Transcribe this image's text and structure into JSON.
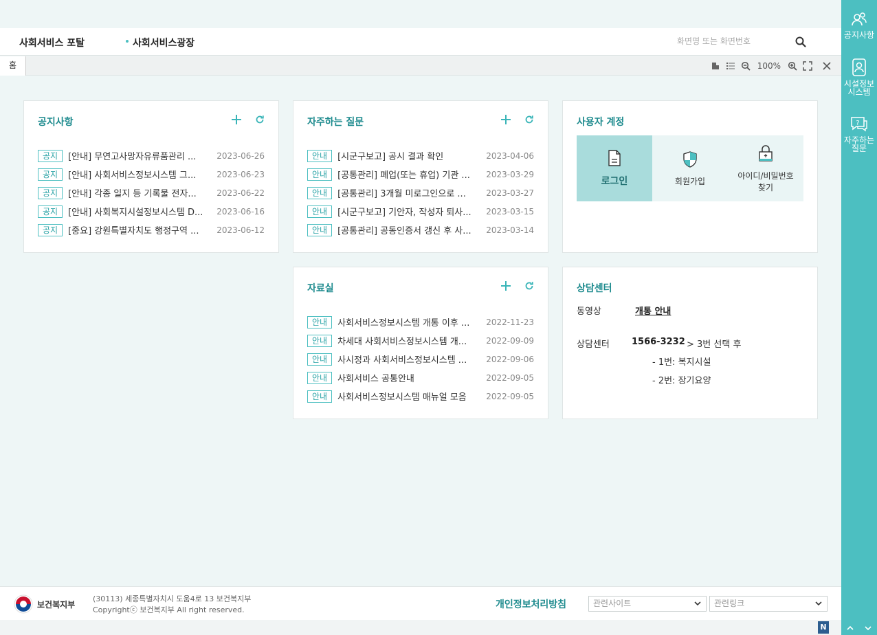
{
  "header": {
    "portal_title": "사회서비스 포탈",
    "nav_item": "사회서비스광장",
    "search_placeholder": "화면명 또는 화면번호"
  },
  "tabs": {
    "home": "홈"
  },
  "toolbar": {
    "zoom": "100%"
  },
  "notice": {
    "title": "공지사항",
    "items": [
      {
        "badge": "공지",
        "text": "[안내] 무연고사망자유류품관리 ...",
        "date": "2023-06-26"
      },
      {
        "badge": "공지",
        "text": "[안내] 사회서비스정보시스템 그...",
        "date": "2023-06-23"
      },
      {
        "badge": "공지",
        "text": "[안내] 각종 일지 등 기록물 전자...",
        "date": "2023-06-22"
      },
      {
        "badge": "공지",
        "text": "[안내] 사회복지시설정보시스템 D...",
        "date": "2023-06-16"
      },
      {
        "badge": "공지",
        "text": "[중요] 강원특별자치도 행정구역 ...",
        "date": "2023-06-12"
      }
    ]
  },
  "faq": {
    "title": "자주하는 질문",
    "items": [
      {
        "badge": "안내",
        "text": "[시군구보고] 공시 결과 확인",
        "date": "2023-04-06"
      },
      {
        "badge": "안내",
        "text": "[공통관리] 폐업(또는 휴업) 기관 ...",
        "date": "2023-03-29"
      },
      {
        "badge": "안내",
        "text": "[공통관리] 3개월 미로그인으로 ...",
        "date": "2023-03-27"
      },
      {
        "badge": "안내",
        "text": "[시군구보고] 기안자, 작성자 퇴사...",
        "date": "2023-03-15"
      },
      {
        "badge": "안내",
        "text": "[공통관리] 공동인증서 갱신 후 사...",
        "date": "2023-03-14"
      }
    ]
  },
  "account": {
    "title": "사용자 계정",
    "login": "로그인",
    "signup": "회원가입",
    "find_line1": "아이디/비밀번호",
    "find_line2": "찾기"
  },
  "library": {
    "title": "자료실",
    "items": [
      {
        "badge": "안내",
        "text": "사회서비스정보시스템 개통 이후 ...",
        "date": "2022-11-23"
      },
      {
        "badge": "안내",
        "text": "차세대 사회서비스정보시스템 개...",
        "date": "2022-09-09"
      },
      {
        "badge": "안내",
        "text": "사시정과 사회서비스정보시스템 ...",
        "date": "2022-09-06"
      },
      {
        "badge": "안내",
        "text": "사회서비스 공통안내",
        "date": "2022-09-05"
      },
      {
        "badge": "안내",
        "text": "사회서비스정보시스템 매뉴얼 모음",
        "date": "2022-09-05"
      }
    ]
  },
  "counsel": {
    "title": "상담센터",
    "video_label": "동영상",
    "video_link": "개통 안내",
    "center_label": "상담센터",
    "phone": "1566-3232",
    "phone_suffix": "> 3번 선택 후",
    "option1": "- 1번: 복지시설",
    "option2": "- 2번: 장기요양"
  },
  "footer": {
    "ministry": "보건복지부",
    "address": "(30113) 세종특별자치시 도움4로 13 보건복지부",
    "copyright": "Copyrightⓒ 보건복지부 All right reserved.",
    "privacy": "개인정보처리방침",
    "related_sites": "관련사이트",
    "related_links": "관련링크",
    "n_badge": "N"
  },
  "rightbar": {
    "notice_label": "공지사항",
    "facility_line1": "시설정보",
    "facility_line2": "시스템",
    "faq_line1": "자주하는",
    "faq_line2": "질문"
  },
  "colors": {
    "accent": "#4cbfc1",
    "title": "#1e8b8e",
    "background": "#eef6f6"
  }
}
